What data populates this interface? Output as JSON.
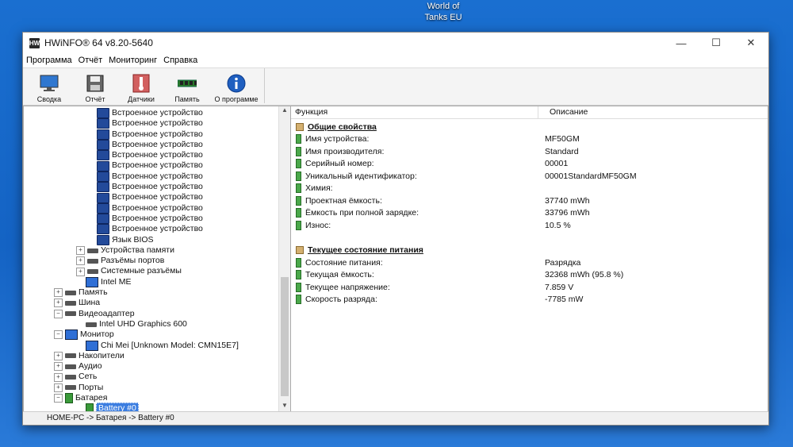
{
  "desktop": {
    "icon_label": "World of Tanks EU"
  },
  "window": {
    "title": "HWiNFO® 64 v8.20-5640",
    "controls": {
      "minimize": "—",
      "maximize": "☐",
      "close": "✕"
    }
  },
  "menu": [
    "Программа",
    "Отчёт",
    "Мониторинг",
    "Справка"
  ],
  "toolbar": [
    {
      "label": "Сводка",
      "icon": "monitor-icon"
    },
    {
      "label": "Отчёт",
      "icon": "save-icon"
    },
    {
      "label": "Датчики",
      "icon": "thermometer-icon"
    },
    {
      "label": "Память",
      "icon": "memory-icon"
    },
    {
      "label": "О программе",
      "icon": "info-icon"
    }
  ],
  "tree": [
    {
      "text": "Встроенное устройство",
      "indent": 5,
      "icon": "chip"
    },
    {
      "text": "Встроенное устройство",
      "indent": 5,
      "icon": "chip"
    },
    {
      "text": "Встроенное устройство",
      "indent": 5,
      "icon": "chip"
    },
    {
      "text": "Встроенное устройство",
      "indent": 5,
      "icon": "chip"
    },
    {
      "text": "Встроенное устройство",
      "indent": 5,
      "icon": "chip"
    },
    {
      "text": "Встроенное устройство",
      "indent": 5,
      "icon": "chip"
    },
    {
      "text": "Встроенное устройство",
      "indent": 5,
      "icon": "chip"
    },
    {
      "text": "Встроенное устройство",
      "indent": 5,
      "icon": "chip"
    },
    {
      "text": "Встроенное устройство",
      "indent": 5,
      "icon": "chip"
    },
    {
      "text": "Встроенное устройство",
      "indent": 5,
      "icon": "chip"
    },
    {
      "text": "Встроенное устройство",
      "indent": 5,
      "icon": "chip"
    },
    {
      "text": "Встроенное устройство",
      "indent": 5,
      "icon": "chip"
    },
    {
      "text": "Язык BIOS",
      "indent": 5,
      "icon": "chip"
    },
    {
      "text": "Устройства памяти",
      "indent": 4,
      "icon": "gray",
      "exp": "+"
    },
    {
      "text": "Разъёмы портов",
      "indent": 4,
      "icon": "gray",
      "exp": "+"
    },
    {
      "text": "Системные разъёмы",
      "indent": 4,
      "icon": "gray",
      "exp": "+"
    },
    {
      "text": "Intel ME",
      "indent": 4,
      "icon": "blue"
    },
    {
      "text": "Память",
      "indent": 2,
      "icon": "gray",
      "exp": "+"
    },
    {
      "text": "Шина",
      "indent": 2,
      "icon": "gray",
      "exp": "+"
    },
    {
      "text": "Видеоадаптер",
      "indent": 2,
      "icon": "gray",
      "exp": "−"
    },
    {
      "text": "Intel UHD Graphics 600",
      "indent": 4,
      "icon": "gray"
    },
    {
      "text": "Монитор",
      "indent": 2,
      "icon": "blue",
      "exp": "−"
    },
    {
      "text": "Chi Mei [Unknown Model: CMN15E7]",
      "indent": 4,
      "icon": "blue"
    },
    {
      "text": "Накопители",
      "indent": 2,
      "icon": "gray",
      "exp": "+"
    },
    {
      "text": "Аудио",
      "indent": 2,
      "icon": "gray",
      "exp": "+"
    },
    {
      "text": "Сеть",
      "indent": 2,
      "icon": "gray",
      "exp": "+"
    },
    {
      "text": "Порты",
      "indent": 2,
      "icon": "gray",
      "exp": "+"
    },
    {
      "text": "Батарея",
      "indent": 2,
      "icon": "green",
      "exp": "−"
    },
    {
      "text": "Battery #0",
      "indent": 4,
      "icon": "green",
      "selected": true
    }
  ],
  "details": {
    "col_func": "Функция",
    "col_desc": "Описание",
    "sections": [
      {
        "title": "Общие свойства",
        "rows": [
          {
            "k": "Имя устройства:",
            "v": "MF50GM"
          },
          {
            "k": "Имя производителя:",
            "v": "Standard"
          },
          {
            "k": "Серийный номер:",
            "v": "00001"
          },
          {
            "k": "Уникальный идентификатор:",
            "v": "00001StandardMF50GM"
          },
          {
            "k": "Химия:",
            "v": ""
          },
          {
            "k": "Проектная ёмкость:",
            "v": "37740 mWh"
          },
          {
            "k": "Ёмкость при полной зарядке:",
            "v": "33796 mWh"
          },
          {
            "k": "Износ:",
            "v": "10.5 %"
          }
        ]
      },
      {
        "title": "Текущее состояние питания",
        "rows": [
          {
            "k": "Состояние питания:",
            "v": "Разрядка"
          },
          {
            "k": "Текущая ёмкость:",
            "v": "32368 mWh (95.8 %)"
          },
          {
            "k": "Текущее напряжение:",
            "v": "7.859 V"
          },
          {
            "k": "Скорость разряда:",
            "v": "-7785 mW"
          }
        ]
      }
    ]
  },
  "status": "HOME-PC -> Батарея -> Battery #0"
}
